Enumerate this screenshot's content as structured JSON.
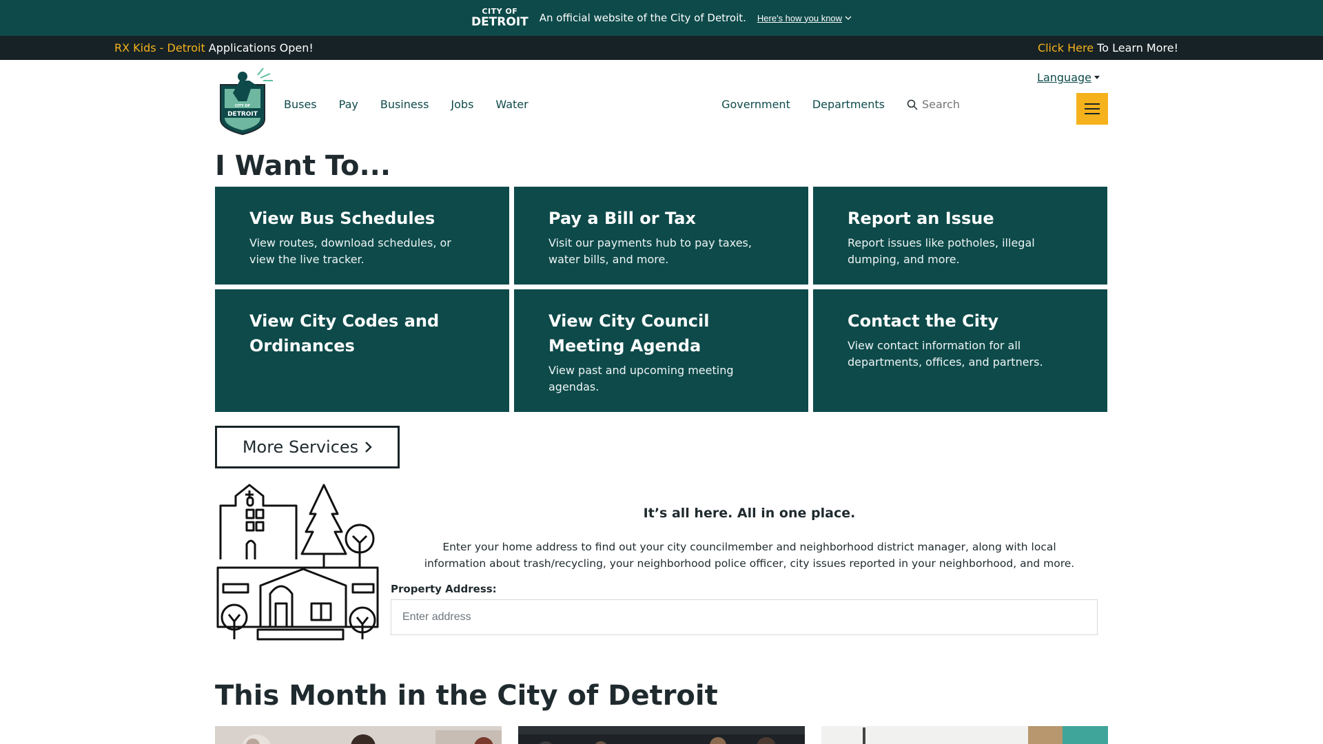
{
  "official_banner": {
    "logo_line1": "CITY OF",
    "logo_line2": "DETROIT",
    "message": "An official website of the City of Detroit.",
    "how_link": "Here's how you know"
  },
  "alert": {
    "left_accent": "RX Kids - Detroit",
    "left_text": " Applications Open!",
    "right_accent": "Click Here",
    "right_text": " To Learn More!"
  },
  "header": {
    "nav_left": [
      "Buses",
      "Pay",
      "Business",
      "Jobs",
      "Water"
    ],
    "nav_right": [
      "Government",
      "Departments"
    ],
    "search_placeholder": "Search",
    "language": "Language",
    "logo_text_top": "CITY OF",
    "logo_text_bottom": "DETROIT"
  },
  "main": {
    "heading": "I Want To...",
    "cards": [
      {
        "title": "View Bus Schedules",
        "desc": "View routes, download schedules, or view the live tracker."
      },
      {
        "title": "Pay a Bill or Tax",
        "desc": "Visit our payments hub to pay taxes, water bills, and more."
      },
      {
        "title": "Report an Issue",
        "desc": "Report issues like potholes, illegal dumping, and more."
      },
      {
        "title": "View City Codes and Ordinances",
        "desc": ""
      },
      {
        "title": "View City Council Meeting Agenda",
        "desc": "View past and upcoming meeting agendas."
      },
      {
        "title": "Contact the City",
        "desc": "View contact information for all departments, offices, and partners."
      }
    ],
    "more_services": "More Services"
  },
  "address_lookup": {
    "tagline": "It’s all here. All in one place.",
    "description_line1": "Enter your home address to find out your city councilmember and neighborhood district manager, along with local",
    "description_line2": "information about trash/recycling, your neighborhood police officer, city issues reported in your neighborhood, and more.",
    "label": "Property Address:",
    "placeholder": "Enter address"
  },
  "news": {
    "heading": "This Month in the City of Detroit"
  },
  "colors": {
    "brand_teal": "#0e4a4a",
    "accent_yellow": "#f5b21c",
    "dark_bar": "#172226"
  }
}
